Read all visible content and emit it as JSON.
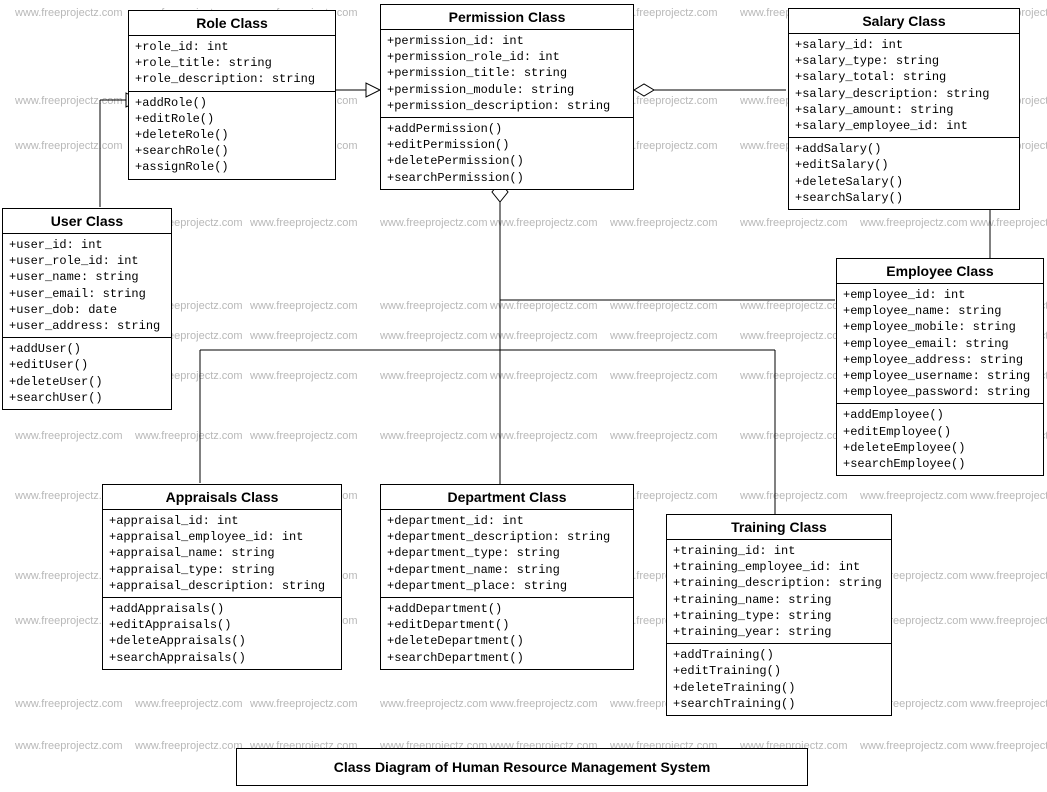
{
  "watermark_text": "www.freeprojectz.com",
  "title": "Class Diagram of Human Resource Management System",
  "classes": {
    "role": {
      "name": "Role Class",
      "attributes": [
        "+role_id: int",
        "+role_title: string",
        "+role_description: string"
      ],
      "methods": [
        "+addRole()",
        "+editRole()",
        "+deleteRole()",
        "+searchRole()",
        "+assignRole()"
      ]
    },
    "permission": {
      "name": "Permission Class",
      "attributes": [
        "+permission_id: int",
        "+permission_role_id: int",
        "+permission_title: string",
        "+permission_module: string",
        "+permission_description: string"
      ],
      "methods": [
        "+addPermission()",
        "+editPermission()",
        "+deletePermission()",
        "+searchPermission()"
      ]
    },
    "salary": {
      "name": "Salary Class",
      "attributes": [
        "+salary_id: int",
        "+salary_type: string",
        "+salary_total: string",
        "+salary_description: string",
        "+salary_amount: string",
        "+salary_employee_id: int"
      ],
      "methods": [
        "+addSalary()",
        "+editSalary()",
        "+deleteSalary()",
        "+searchSalary()"
      ]
    },
    "user": {
      "name": "User Class",
      "attributes": [
        "+user_id: int",
        "+user_role_id: int",
        "+user_name: string",
        "+user_email: string",
        "+user_dob: date",
        "+user_address: string"
      ],
      "methods": [
        "+addUser()",
        "+editUser()",
        "+deleteUser()",
        "+searchUser()"
      ]
    },
    "employee": {
      "name": "Employee Class",
      "attributes": [
        "+employee_id: int",
        "+employee_name: string",
        "+employee_mobile: string",
        "+employee_email: string",
        "+employee_address: string",
        "+employee_username: string",
        "+employee_password: string"
      ],
      "methods": [
        "+addEmployee()",
        "+editEmployee()",
        "+deleteEmployee()",
        "+searchEmployee()"
      ]
    },
    "appraisals": {
      "name": "Appraisals Class",
      "attributes": [
        "+appraisal_id: int",
        "+appraisal_employee_id: int",
        "+appraisal_name: string",
        "+appraisal_type: string",
        "+appraisal_description: string"
      ],
      "methods": [
        "+addAppraisals()",
        "+editAppraisals()",
        "+deleteAppraisals()",
        "+searchAppraisals()"
      ]
    },
    "department": {
      "name": "Department Class",
      "attributes": [
        "+department_id: int",
        "+department_description: string",
        "+department_type: string",
        "+department_name: string",
        "+department_place: string"
      ],
      "methods": [
        "+addDepartment()",
        "+editDepartment()",
        "+deleteDepartment()",
        "+searchDepartment()"
      ]
    },
    "training": {
      "name": "Training Class",
      "attributes": [
        "+training_id: int",
        "+training_employee_id: int",
        "+training_description: string",
        "+training_name: string",
        "+training_type: string",
        "+training_year: string"
      ],
      "methods": [
        "+addTraining()",
        "+editTraining()",
        "+deleteTraining()",
        "+searchTraining()"
      ]
    }
  }
}
